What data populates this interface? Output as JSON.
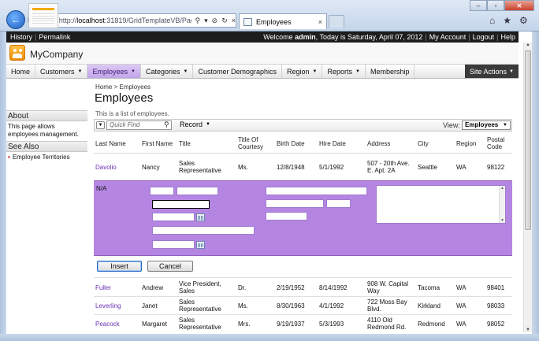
{
  "browser": {
    "url_prefix": "http://",
    "url_host": "localhost",
    "url_rest": ":31819/GridTemplateVB/Page",
    "tab_title": "Employees",
    "tab_close": "×",
    "addr_icons": [
      "⚲",
      "▾",
      "⊘",
      "↻",
      "×"
    ],
    "window_buttons": [
      "–",
      "▫",
      "✕"
    ],
    "toolbar_icons": [
      "⌂",
      "★",
      "⚙"
    ]
  },
  "topbar": {
    "history": "History",
    "permalink": "Permalink",
    "welcome_pre": "Welcome ",
    "user": "admin",
    "welcome_post": ", Today is Saturday, April 07, 2012",
    "my_account": "My Account",
    "logout": "Logout",
    "help": "Help",
    "sep": "|"
  },
  "header": {
    "company": "MyCompany"
  },
  "menu": {
    "items": [
      {
        "label": "Home",
        "dropdown": false
      },
      {
        "label": "Customers",
        "dropdown": true
      },
      {
        "label": "Employees",
        "dropdown": true
      },
      {
        "label": "Categories",
        "dropdown": true
      },
      {
        "label": "Customer Demographics",
        "dropdown": false
      },
      {
        "label": "Region",
        "dropdown": true
      },
      {
        "label": "Reports",
        "dropdown": true
      },
      {
        "label": "Membership",
        "dropdown": false
      }
    ],
    "selected_index": 2,
    "site_actions": "Site Actions"
  },
  "sidebar": {
    "about_title": "About",
    "about_text": "This page allows employees management.",
    "see_also_title": "See Also",
    "see_also_items": [
      "Employee Territories"
    ]
  },
  "page": {
    "breadcrumb_home": "Home",
    "breadcrumb_sep": ">",
    "breadcrumb_current": "Employees",
    "title": "Employees",
    "description": "This is a list of employees."
  },
  "toolbar": {
    "quick_find_placeholder": "Quick Find",
    "record": "Record",
    "view_label": "View:",
    "view_value": "Employees"
  },
  "grid": {
    "columns": [
      "Last Name",
      "First Name",
      "Title",
      "Title Of Courtesy",
      "Birth Date",
      "Hire Date",
      "Address",
      "City",
      "Region",
      "Postal Code"
    ],
    "rows_top": [
      {
        "last": "Davolio",
        "first": "Nancy",
        "title": "Sales Representative",
        "courtesy": "Ms.",
        "birth": "12/8/1948",
        "hire": "5/1/1992",
        "address": "507 - 20th Ave. E. Apt. 2A",
        "city": "Seattle",
        "region": "WA",
        "postal": "98122"
      }
    ],
    "rows_bottom": [
      {
        "last": "Fuller",
        "first": "Andrew",
        "title": "Vice President, Sales",
        "courtesy": "Dr.",
        "birth": "2/19/1952",
        "hire": "8/14/1992",
        "address": "908 W. Capital Way",
        "city": "Tacoma",
        "region": "WA",
        "postal": "98401"
      },
      {
        "last": "Leverling",
        "first": "Janet",
        "title": "Sales Representative",
        "courtesy": "Ms.",
        "birth": "8/30/1963",
        "hire": "4/1/1992",
        "address": "722 Moss Bay Blvd.",
        "city": "Kirkland",
        "region": "WA",
        "postal": "98033"
      },
      {
        "last": "Peacock",
        "first": "Margaret",
        "title": "Sales Representative",
        "courtesy": "Mrs.",
        "birth": "9/19/1937",
        "hire": "5/3/1993",
        "address": "4110 Old Redmond Rd.",
        "city": "Redmond",
        "region": "WA",
        "postal": "98052"
      }
    ]
  },
  "form": {
    "na": "N/A",
    "insert": "Insert",
    "cancel": "Cancel"
  }
}
